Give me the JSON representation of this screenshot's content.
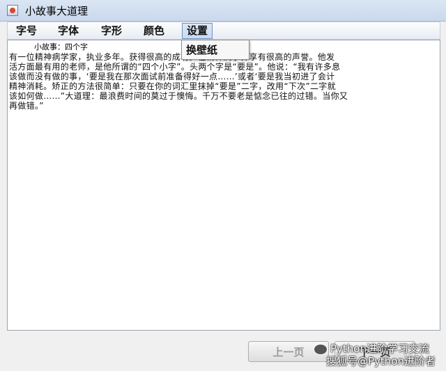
{
  "window": {
    "title": "小故事大道理"
  },
  "menubar": {
    "items": [
      "字号",
      "字体",
      "字形",
      "颜色",
      "设置"
    ],
    "active": "设置"
  },
  "dropdown": {
    "item": "换壁纸"
  },
  "content": {
    "heading": "小故事：四个字",
    "lines": [
      " 有一位精神病学家，执业多年。获得很高的成功。在精神病学界享有很高的声誉。他发",
      "活方面最有用的老师，是他所谓的“四个小字”。头两个字是“要是”。他说：“我有许多息",
      "该做而没有做的事，‘要是我在那次面试前准备得好一点……’或者‘要是我当初进了会计",
      "精神消耗。矫正的方法很简单：只要在你的词汇里抹掉“要是”二字，改用“下次”二字就",
      "该如何做……”大道理：最浪费时间的莫过于懊悔。千万不要老是惦念已往的过错。当你又",
      "再做错。”"
    ]
  },
  "buttons": {
    "prev": "上一页",
    "next": "下一页"
  },
  "watermark": {
    "line1": "Python进阶学习交流",
    "line2": "搜狐号@Python进阶者"
  }
}
